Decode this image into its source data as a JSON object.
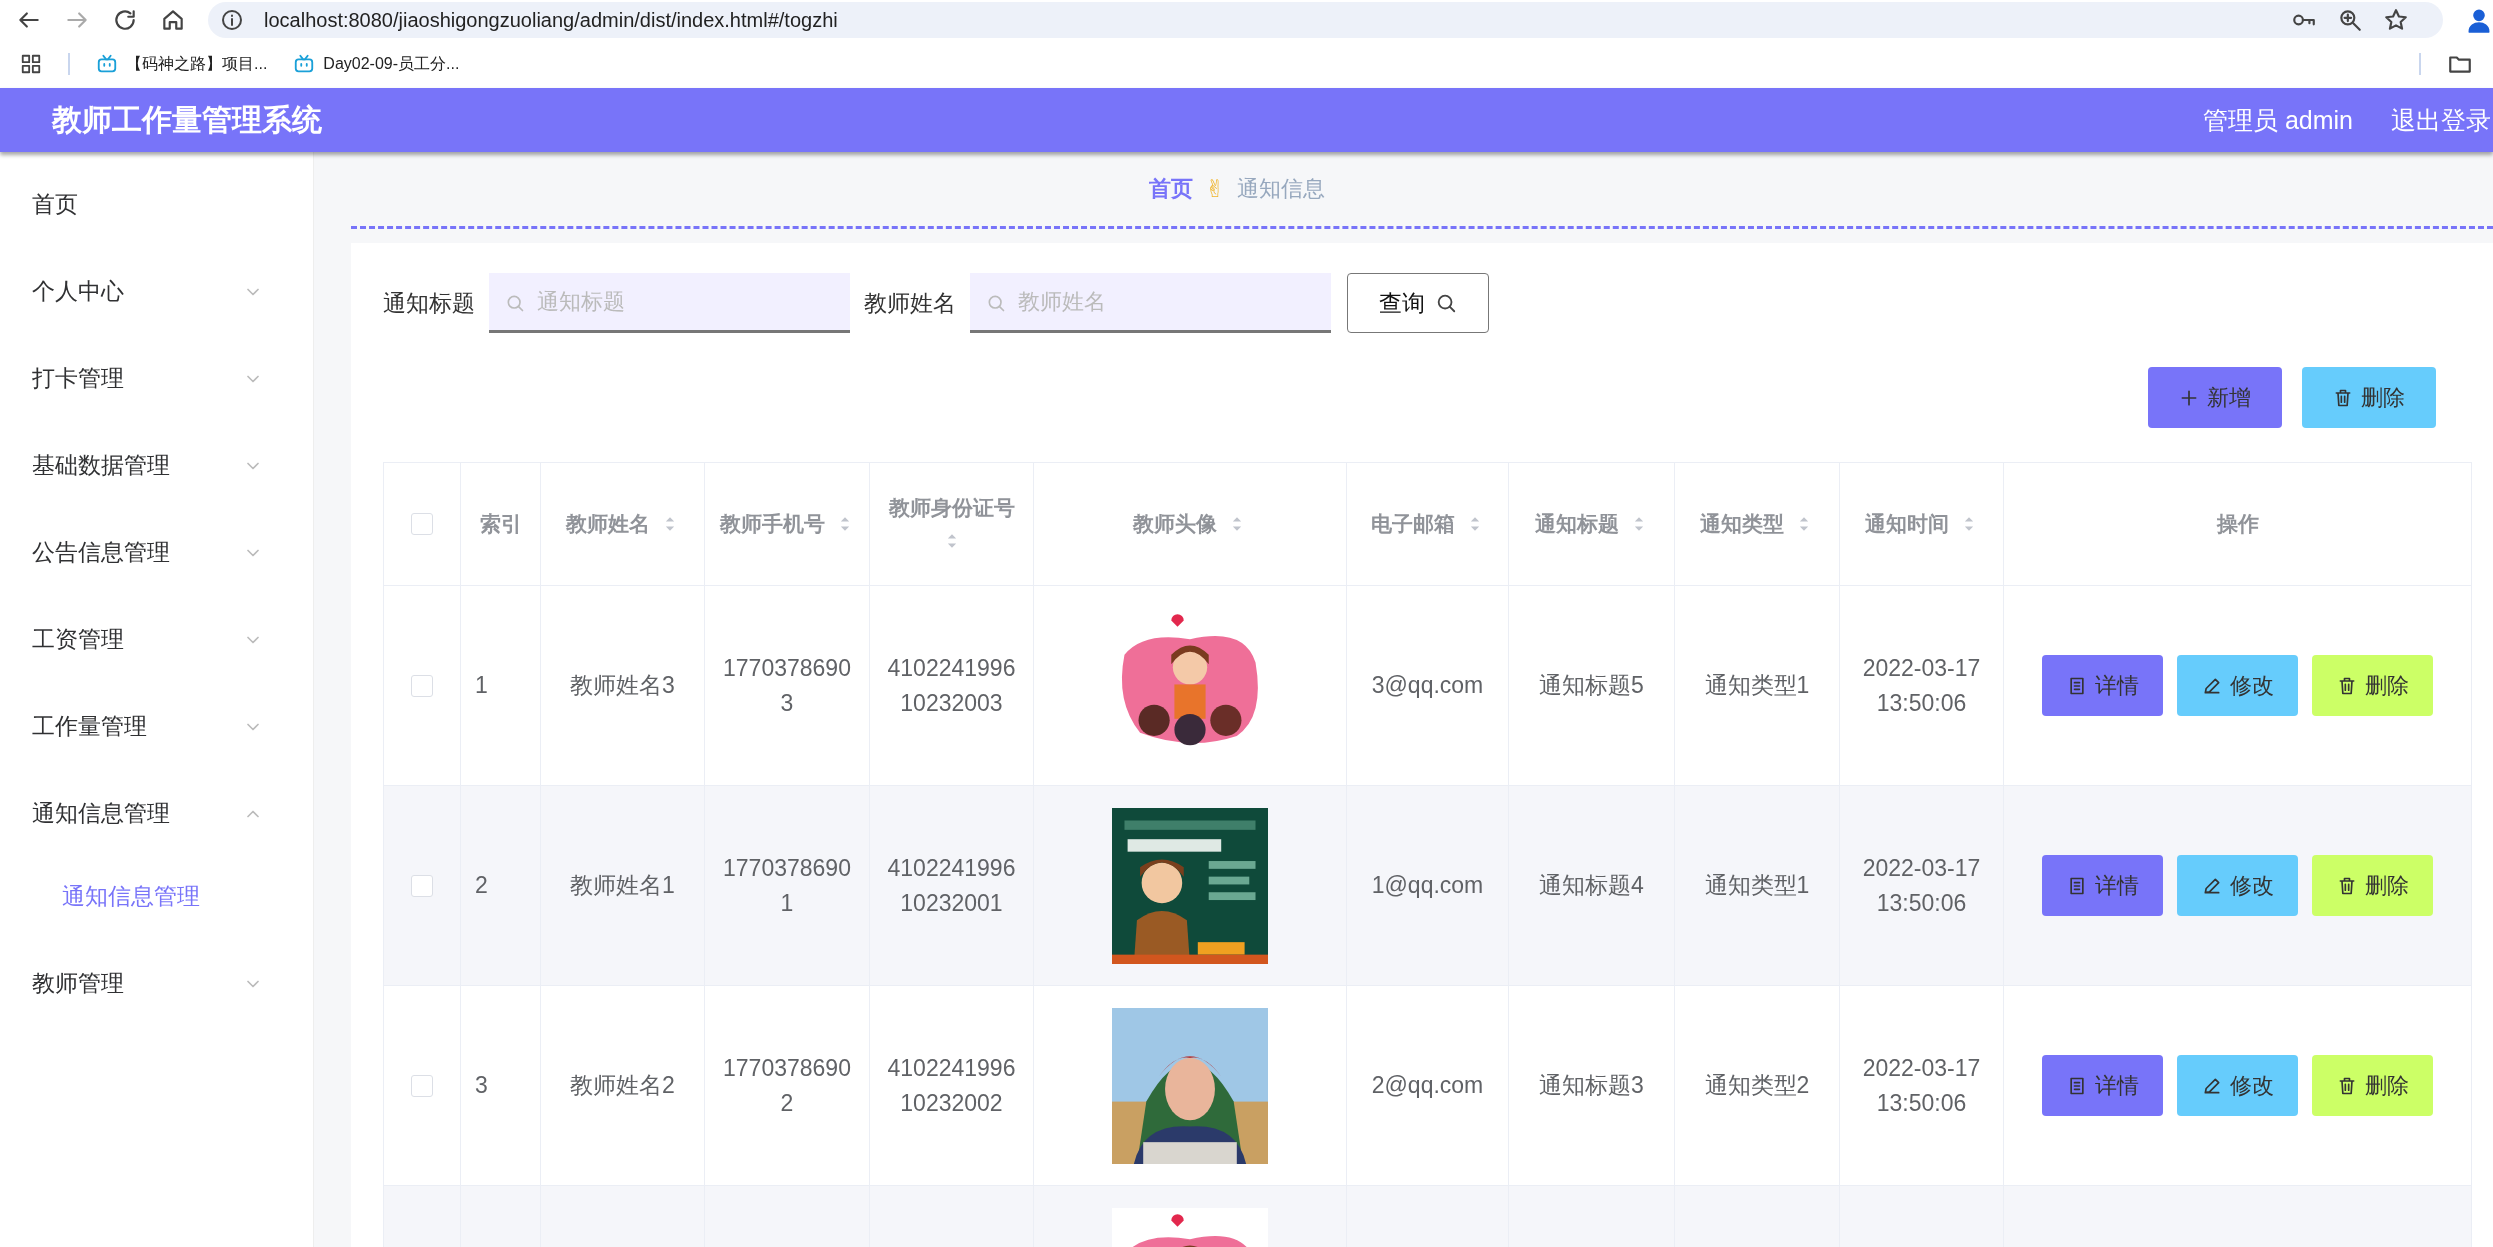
{
  "browser": {
    "url": "localhost:8080/jiaoshigongzuoliang/admin/dist/index.html#/togzhi",
    "bookmarks": [
      "【码神之路】项目...",
      "Day02-09-员工分..."
    ]
  },
  "header": {
    "title": "教师工作量管理系统",
    "user": "管理员 admin",
    "logout": "退出登录"
  },
  "sidebar": {
    "items": [
      {
        "label": "首页",
        "has_children": false
      },
      {
        "label": "个人中心",
        "expanded": false,
        "has_children": true
      },
      {
        "label": "打卡管理",
        "expanded": false,
        "has_children": true
      },
      {
        "label": "基础数据管理",
        "expanded": false,
        "has_children": true
      },
      {
        "label": "公告信息管理",
        "expanded": false,
        "has_children": true
      },
      {
        "label": "工资管理",
        "expanded": false,
        "has_children": true
      },
      {
        "label": "工作量管理",
        "expanded": false,
        "has_children": true
      },
      {
        "label": "通知信息管理",
        "expanded": true,
        "has_children": true,
        "children": [
          {
            "label": "通知信息管理",
            "selected": true
          }
        ]
      },
      {
        "label": "教师管理",
        "expanded": false,
        "has_children": true
      }
    ]
  },
  "breadcrumb": {
    "items": [
      "首页",
      "通知信息"
    ],
    "separator": "✌"
  },
  "search": {
    "fields": [
      {
        "label": "通知标题",
        "placeholder": "通知标题"
      },
      {
        "label": "教师姓名",
        "placeholder": "教师姓名"
      }
    ],
    "button": "查询"
  },
  "actions": [
    {
      "label": "新增",
      "kind": "add"
    },
    {
      "label": "删除",
      "kind": "delete"
    }
  ],
  "table": {
    "select_all": {
      "checked": false
    },
    "columns": [
      {
        "kind": "check"
      },
      {
        "label": "索引",
        "sortable": false
      },
      {
        "label": "教师姓名",
        "sortable": true
      },
      {
        "label": "教师手机号",
        "sortable": true
      },
      {
        "label": "教师身份证号",
        "sortable": true
      },
      {
        "label": "教师头像",
        "sortable": true
      },
      {
        "label": "电子邮箱",
        "sortable": true
      },
      {
        "label": "通知标题",
        "sortable": true
      },
      {
        "label": "通知类型",
        "sortable": true
      },
      {
        "label": "通知时间",
        "sortable": true
      },
      {
        "label": "操作",
        "sortable": false
      }
    ],
    "rows": [
      {
        "checked": false,
        "index": "1",
        "name": "教师姓名3",
        "phone": "17703786903",
        "id_card": "410224199610232003",
        "avatar": {
          "kind": "picture"
        },
        "email": "3@qq.com",
        "title": "通知标题5",
        "type": "通知类型1",
        "time": "2022-03-17 13:50:06",
        "buttons": [
          {
            "label": "详情",
            "kind": "detail"
          },
          {
            "label": "修改",
            "kind": "edit"
          },
          {
            "label": "删除",
            "kind": "delete"
          }
        ]
      },
      {
        "checked": false,
        "index": "2",
        "name": "教师姓名1",
        "phone": "17703786901",
        "id_card": "410224199610232001",
        "avatar": {
          "kind": "picture"
        },
        "email": "1@qq.com",
        "title": "通知标题4",
        "type": "通知类型1",
        "time": "2022-03-17 13:50:06",
        "buttons": [
          {
            "label": "详情",
            "kind": "detail"
          },
          {
            "label": "修改",
            "kind": "edit"
          },
          {
            "label": "删除",
            "kind": "delete"
          }
        ]
      },
      {
        "checked": false,
        "index": "3",
        "name": "教师姓名2",
        "phone": "17703786902",
        "id_card": "410224199610232002",
        "avatar": {
          "kind": "picture"
        },
        "email": "2@qq.com",
        "title": "通知标题3",
        "type": "通知类型2",
        "time": "2022-03-17 13:50:06",
        "buttons": [
          {
            "label": "详情",
            "kind": "detail"
          },
          {
            "label": "修改",
            "kind": "edit"
          },
          {
            "label": "删除",
            "kind": "delete"
          }
        ]
      },
      {
        "avatar": {
          "kind": "picture"
        }
      }
    ]
  }
}
